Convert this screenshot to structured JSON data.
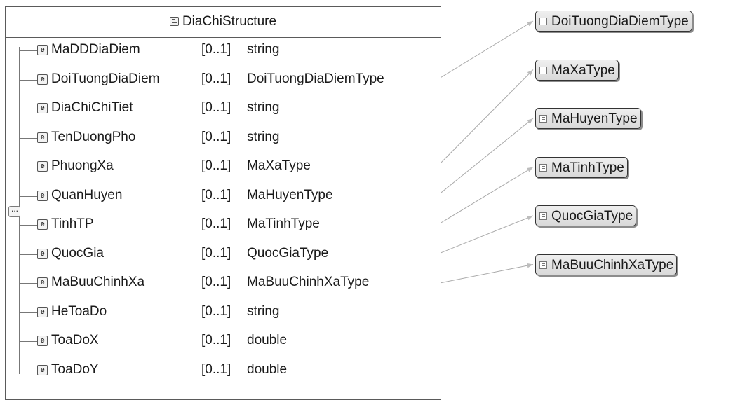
{
  "structure": {
    "title": "DiaChiStructure",
    "elements": [
      {
        "name": "MaDDDiaDiem",
        "cardinality": "[0..1]",
        "type": "string"
      },
      {
        "name": "DoiTuongDiaDiem",
        "cardinality": "[0..1]",
        "type": "DoiTuongDiaDiemType"
      },
      {
        "name": "DiaChiChiTiet",
        "cardinality": "[0..1]",
        "type": "string"
      },
      {
        "name": "TenDuongPho",
        "cardinality": "[0..1]",
        "type": "string"
      },
      {
        "name": "PhuongXa",
        "cardinality": "[0..1]",
        "type": "MaXaType"
      },
      {
        "name": "QuanHuyen",
        "cardinality": "[0..1]",
        "type": "MaHuyenType"
      },
      {
        "name": "TinhTP",
        "cardinality": "[0..1]",
        "type": "MaTinhType"
      },
      {
        "name": "QuocGia",
        "cardinality": "[0..1]",
        "type": "QuocGiaType"
      },
      {
        "name": "MaBuuChinhXa",
        "cardinality": "[0..1]",
        "type": "MaBuuChinhXaType"
      },
      {
        "name": "HeToaDo",
        "cardinality": "[0..1]",
        "type": "string"
      },
      {
        "name": "ToaDoX",
        "cardinality": "[0..1]",
        "type": "double"
      },
      {
        "name": "ToaDoY",
        "cardinality": "[0..1]",
        "type": "double"
      }
    ]
  },
  "simple_types": [
    {
      "name": "DoiTuongDiaDiemType"
    },
    {
      "name": "MaXaType"
    },
    {
      "name": "MaHuyenType"
    },
    {
      "name": "MaTinhType"
    },
    {
      "name": "QuocGiaType"
    },
    {
      "name": "MaBuuChinhXaType"
    }
  ],
  "links": [
    {
      "from": 1,
      "to": 0
    },
    {
      "from": 4,
      "to": 1
    },
    {
      "from": 5,
      "to": 2
    },
    {
      "from": 6,
      "to": 3
    },
    {
      "from": 7,
      "to": 4
    },
    {
      "from": 8,
      "to": 5
    }
  ],
  "colors": {
    "line": "#a9a9a9",
    "box_border": "#333333"
  }
}
